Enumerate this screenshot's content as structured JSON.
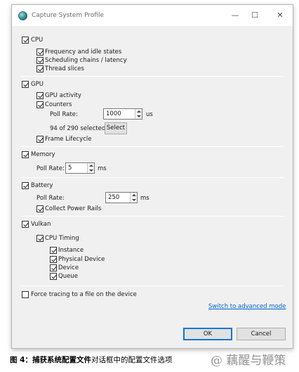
{
  "window": {
    "title": "Capture System Profile",
    "minimize": "—",
    "maximize": "☐",
    "close": "✕"
  },
  "sections": {
    "cpu": {
      "label": "CPU",
      "checked": true,
      "items": [
        {
          "label": "Frequency and idle states",
          "checked": true
        },
        {
          "label": "Scheduling chains / latency",
          "checked": true
        },
        {
          "label": "Thread slices",
          "checked": true
        }
      ]
    },
    "gpu": {
      "label": "GPU",
      "checked": true,
      "gpu_activity": {
        "label": "GPU activity",
        "checked": true
      },
      "counters": {
        "label": "Counters",
        "checked": true
      },
      "poll_rate_label": "Poll Rate:",
      "poll_rate_value": "1000",
      "poll_rate_unit": "us",
      "selected_text": "94 of 290 selected",
      "select_button": "Select",
      "frame_lifecycle": {
        "label": "Frame Lifecycle",
        "checked": true
      }
    },
    "memory": {
      "label": "Memory",
      "checked": true,
      "poll_rate_label": "Poll Rate:",
      "poll_rate_value": "5",
      "poll_rate_unit": "ms"
    },
    "battery": {
      "label": "Battery",
      "checked": true,
      "poll_rate_label": "Poll Rate:",
      "poll_rate_value": "250",
      "poll_rate_unit": "ms",
      "collect_power_rails": {
        "label": "Collect Power Rails",
        "checked": true
      }
    },
    "vulkan": {
      "label": "Vulkan",
      "checked": true,
      "cpu_timing": {
        "label": "CPU Timing",
        "checked": true
      },
      "items": [
        {
          "label": "Instance",
          "checked": true
        },
        {
          "label": "Physical Device",
          "checked": true
        },
        {
          "label": "Device",
          "checked": true
        },
        {
          "label": "Queue",
          "checked": true
        }
      ]
    }
  },
  "force_tracing": {
    "label": "Force tracing to a file on the device",
    "checked": false
  },
  "advanced_link": "Switch to advanced mode",
  "buttons": {
    "ok": "OK",
    "cancel": "Cancel"
  },
  "caption": {
    "bold": "图 4：捕获系统配置文件",
    "rest": "对话框中的配置文件选项"
  },
  "watermark": "@ 藕醒与鞭策"
}
